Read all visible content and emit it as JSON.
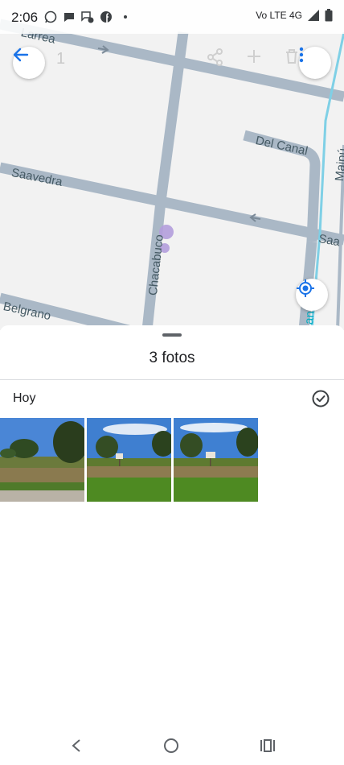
{
  "status_bar": {
    "time": "2:06",
    "notification_icons": [
      "whatsapp-icon",
      "chat-icon",
      "messages-icon",
      "facebook-icon",
      "dot-icon"
    ],
    "network": "Vo LTE 4G"
  },
  "map": {
    "streets": [
      "Larrea",
      "Del Canal",
      "Saavedra",
      "Chacabuco",
      "Belgrano",
      "Saa",
      "Maipú",
      "anal"
    ],
    "ghost_counter": "1"
  },
  "sheet": {
    "title": "3 fotos",
    "section_label": "Hoy",
    "photos": [
      "photo-1",
      "photo-2",
      "photo-3"
    ]
  },
  "colors": {
    "accent": "#1a73e8",
    "road": "#aab8c6",
    "canal": "#7fd0e6",
    "pin": "#b39ddb"
  }
}
